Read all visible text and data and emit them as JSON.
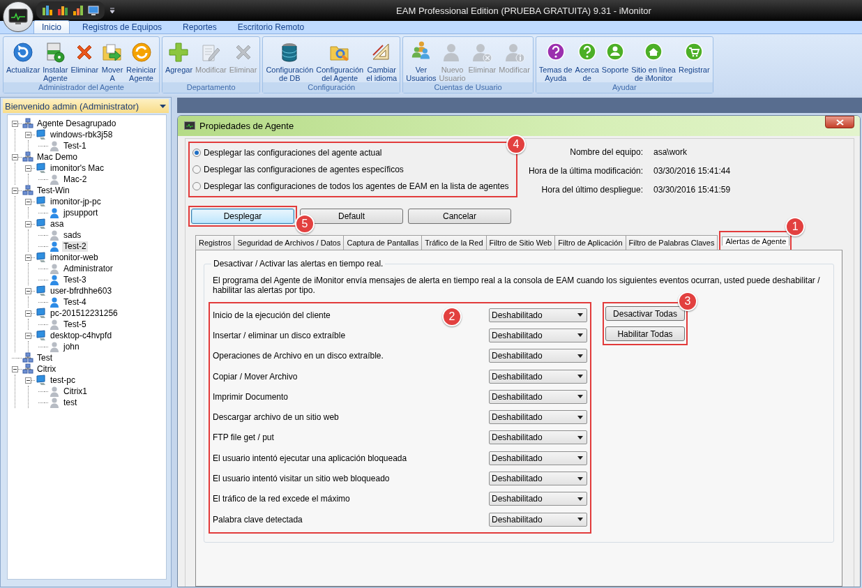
{
  "window": {
    "title": "EAM Professional Edition (PRUEBA GRATUITA) 9.31 - iMonitor"
  },
  "ribbon": {
    "tabs": [
      {
        "label": "Inicio",
        "selected": true
      },
      {
        "label": "Registros de Equipos",
        "selected": false
      },
      {
        "label": "Reportes",
        "selected": false
      },
      {
        "label": "Escritorio Remoto",
        "selected": false
      }
    ],
    "groups": [
      {
        "title": "Administrador del Agente",
        "buttons": [
          {
            "label": "Actualizar",
            "disabled": false
          },
          {
            "label": "Instalar\nAgente",
            "disabled": false
          },
          {
            "label": "Eliminar",
            "disabled": false
          },
          {
            "label": "Mover\nA",
            "disabled": false
          },
          {
            "label": "Reiniciar\nAgente",
            "disabled": false
          }
        ]
      },
      {
        "title": "Departamento",
        "buttons": [
          {
            "label": "Agregar",
            "disabled": false
          },
          {
            "label": "Modificar",
            "disabled": true
          },
          {
            "label": "Eliminar",
            "disabled": true
          }
        ]
      },
      {
        "title": "Configuración",
        "buttons": [
          {
            "label": "Configuración\nde DB",
            "disabled": false
          },
          {
            "label": "Configuración\ndel Agente",
            "disabled": false
          },
          {
            "label": "Cambiar\nel idioma",
            "disabled": false
          }
        ]
      },
      {
        "title": "Cuentas de Usuario",
        "buttons": [
          {
            "label": "Ver\nUsuarios",
            "disabled": false
          },
          {
            "label": "Nuevo\nUsuario",
            "disabled": true
          },
          {
            "label": "Eliminar",
            "disabled": true
          },
          {
            "label": "Modificar",
            "disabled": true
          }
        ]
      },
      {
        "title": "Ayudar",
        "buttons": [
          {
            "label": "Temas de\nAyuda",
            "disabled": false
          },
          {
            "label": "Acerca\nde",
            "disabled": false
          },
          {
            "label": "Soporte",
            "disabled": false
          },
          {
            "label": "Sitio en línea\nde iMonitor",
            "disabled": false
          },
          {
            "label": "Registrar",
            "disabled": false
          }
        ]
      }
    ]
  },
  "sidebar": {
    "header": "Bienvenido admin (Administrator)",
    "tree": [
      {
        "label": "Agente Desagrupado",
        "kind": "group",
        "selected": false,
        "children": [
          {
            "label": "windows-rbk3j58",
            "kind": "computer",
            "selected": false,
            "children": [
              {
                "label": "Test-1",
                "kind": "user",
                "online": false,
                "selected": false
              }
            ]
          }
        ]
      },
      {
        "label": "Mac Demo",
        "kind": "group",
        "selected": false,
        "children": [
          {
            "label": "imonitor's Mac",
            "kind": "computer",
            "selected": false,
            "children": [
              {
                "label": "Mac-2",
                "kind": "user",
                "online": false,
                "selected": false
              }
            ]
          }
        ]
      },
      {
        "label": "Test-Win",
        "kind": "group",
        "selected": false,
        "children": [
          {
            "label": "imonitor-jp-pc",
            "kind": "computer",
            "selected": false,
            "children": [
              {
                "label": "jpsupport",
                "kind": "user",
                "online": true,
                "selected": false
              }
            ]
          },
          {
            "label": "asa",
            "kind": "computer",
            "selected": false,
            "children": [
              {
                "label": "sads",
                "kind": "user",
                "online": false,
                "selected": false
              },
              {
                "label": "Test-2",
                "kind": "user",
                "online": true,
                "selected": true
              }
            ]
          },
          {
            "label": "imonitor-web",
            "kind": "computer",
            "selected": false,
            "children": [
              {
                "label": "Administrator",
                "kind": "user",
                "online": false,
                "selected": false
              },
              {
                "label": "Test-3",
                "kind": "user",
                "online": true,
                "selected": false
              }
            ]
          },
          {
            "label": "user-bfrdhhe603",
            "kind": "computer",
            "selected": false,
            "children": [
              {
                "label": "Test-4",
                "kind": "user",
                "online": true,
                "selected": false
              }
            ]
          },
          {
            "label": "pc-201512231256",
            "kind": "computer",
            "selected": false,
            "children": [
              {
                "label": "Test-5",
                "kind": "user",
                "online": false,
                "selected": false
              }
            ]
          },
          {
            "label": "desktop-c4hvpfd",
            "kind": "computer",
            "selected": false,
            "children": [
              {
                "label": "john",
                "kind": "user",
                "online": false,
                "selected": false
              }
            ]
          }
        ]
      },
      {
        "label": "Test",
        "kind": "group",
        "selected": false
      },
      {
        "label": "Citrix",
        "kind": "group",
        "selected": false,
        "children": [
          {
            "label": "test-pc",
            "kind": "computer",
            "selected": false,
            "children": [
              {
                "label": "Citrix1",
                "kind": "user",
                "online": false,
                "selected": false
              },
              {
                "label": "test",
                "kind": "user",
                "online": false,
                "selected": false
              }
            ]
          }
        ]
      }
    ]
  },
  "dialog": {
    "title": "Propiedades de Agente",
    "deploy_options": {
      "callout": "4",
      "options": [
        {
          "label": "Desplegar las configuraciones del agente actual",
          "selected": true
        },
        {
          "label": "Desplegar las configuraciones de agentes específicos",
          "selected": false
        },
        {
          "label": "Desplegar las configuraciones de todos los agentes de EAM en la lista de agentes",
          "selected": false
        }
      ]
    },
    "info": [
      {
        "label": "Nombre del equipo:",
        "value": "asa\\work"
      },
      {
        "label": "Hora de la última modificación:",
        "value": "03/30/2016 15:41:44"
      },
      {
        "label": "Hora del último despliegue:",
        "value": "03/30/2016 15:41:59"
      }
    ],
    "buttons": [
      {
        "label": "Desplegar",
        "focused": true,
        "callout": "5"
      },
      {
        "label": "Default",
        "focused": false
      },
      {
        "label": "Cancelar",
        "focused": false
      }
    ],
    "tabs": [
      {
        "label": "Registros",
        "selected": false
      },
      {
        "label": "Seguridad de Archivos / Datos",
        "selected": false
      },
      {
        "label": "Captura de Pantallas",
        "selected": false
      },
      {
        "label": "Tráfico de la Red",
        "selected": false
      },
      {
        "label": "Filtro de Sitio Web",
        "selected": false
      },
      {
        "label": "Filtro de Aplicación",
        "selected": false
      },
      {
        "label": "Filtro de Palabras Claves",
        "selected": false
      },
      {
        "label": "Alertas de Agente",
        "selected": true,
        "callout": "1"
      }
    ],
    "alerts": {
      "legend": "Desactivar / Activar las alertas en tiempo real.",
      "description": "El programa del Agente de iMonitor envía mensajes de alerta en tiempo real a la consola de EAM cuando los siguientes eventos ocurran, usted puede deshabilitar / habilitar las alertas por tipo.",
      "callout": "2",
      "rows": [
        {
          "label": "Inicio de la ejecución del cliente",
          "value": "Deshabilitado"
        },
        {
          "label": "Insertar / eliminar un disco extraíble",
          "value": "Deshabilitado"
        },
        {
          "label": "Operaciones de Archivo en un disco extraíble.",
          "value": "Deshabilitado"
        },
        {
          "label": "Copiar / Mover Archivo",
          "value": "Deshabilitado"
        },
        {
          "label": "Imprimir Documento",
          "value": "Deshabilitado"
        },
        {
          "label": "Descargar archivo de un sitio web",
          "value": "Deshabilitado"
        },
        {
          "label": "FTP file get / put",
          "value": "Deshabilitado"
        },
        {
          "label": "El usuario intentó ejecutar una aplicación bloqueada",
          "value": "Deshabilitado"
        },
        {
          "label": "El usuario intentó visitar un sitio web bloqueado",
          "value": "Deshabilitado"
        },
        {
          "label": "El tráfico de la red excede el máximo",
          "value": "Deshabilitado"
        },
        {
          "label": "Palabra clave detectada",
          "value": "Deshabilitado"
        }
      ],
      "buttons_callout": "3",
      "buttons": [
        "Desactivar Todas",
        "Habilitar Todas"
      ]
    }
  }
}
